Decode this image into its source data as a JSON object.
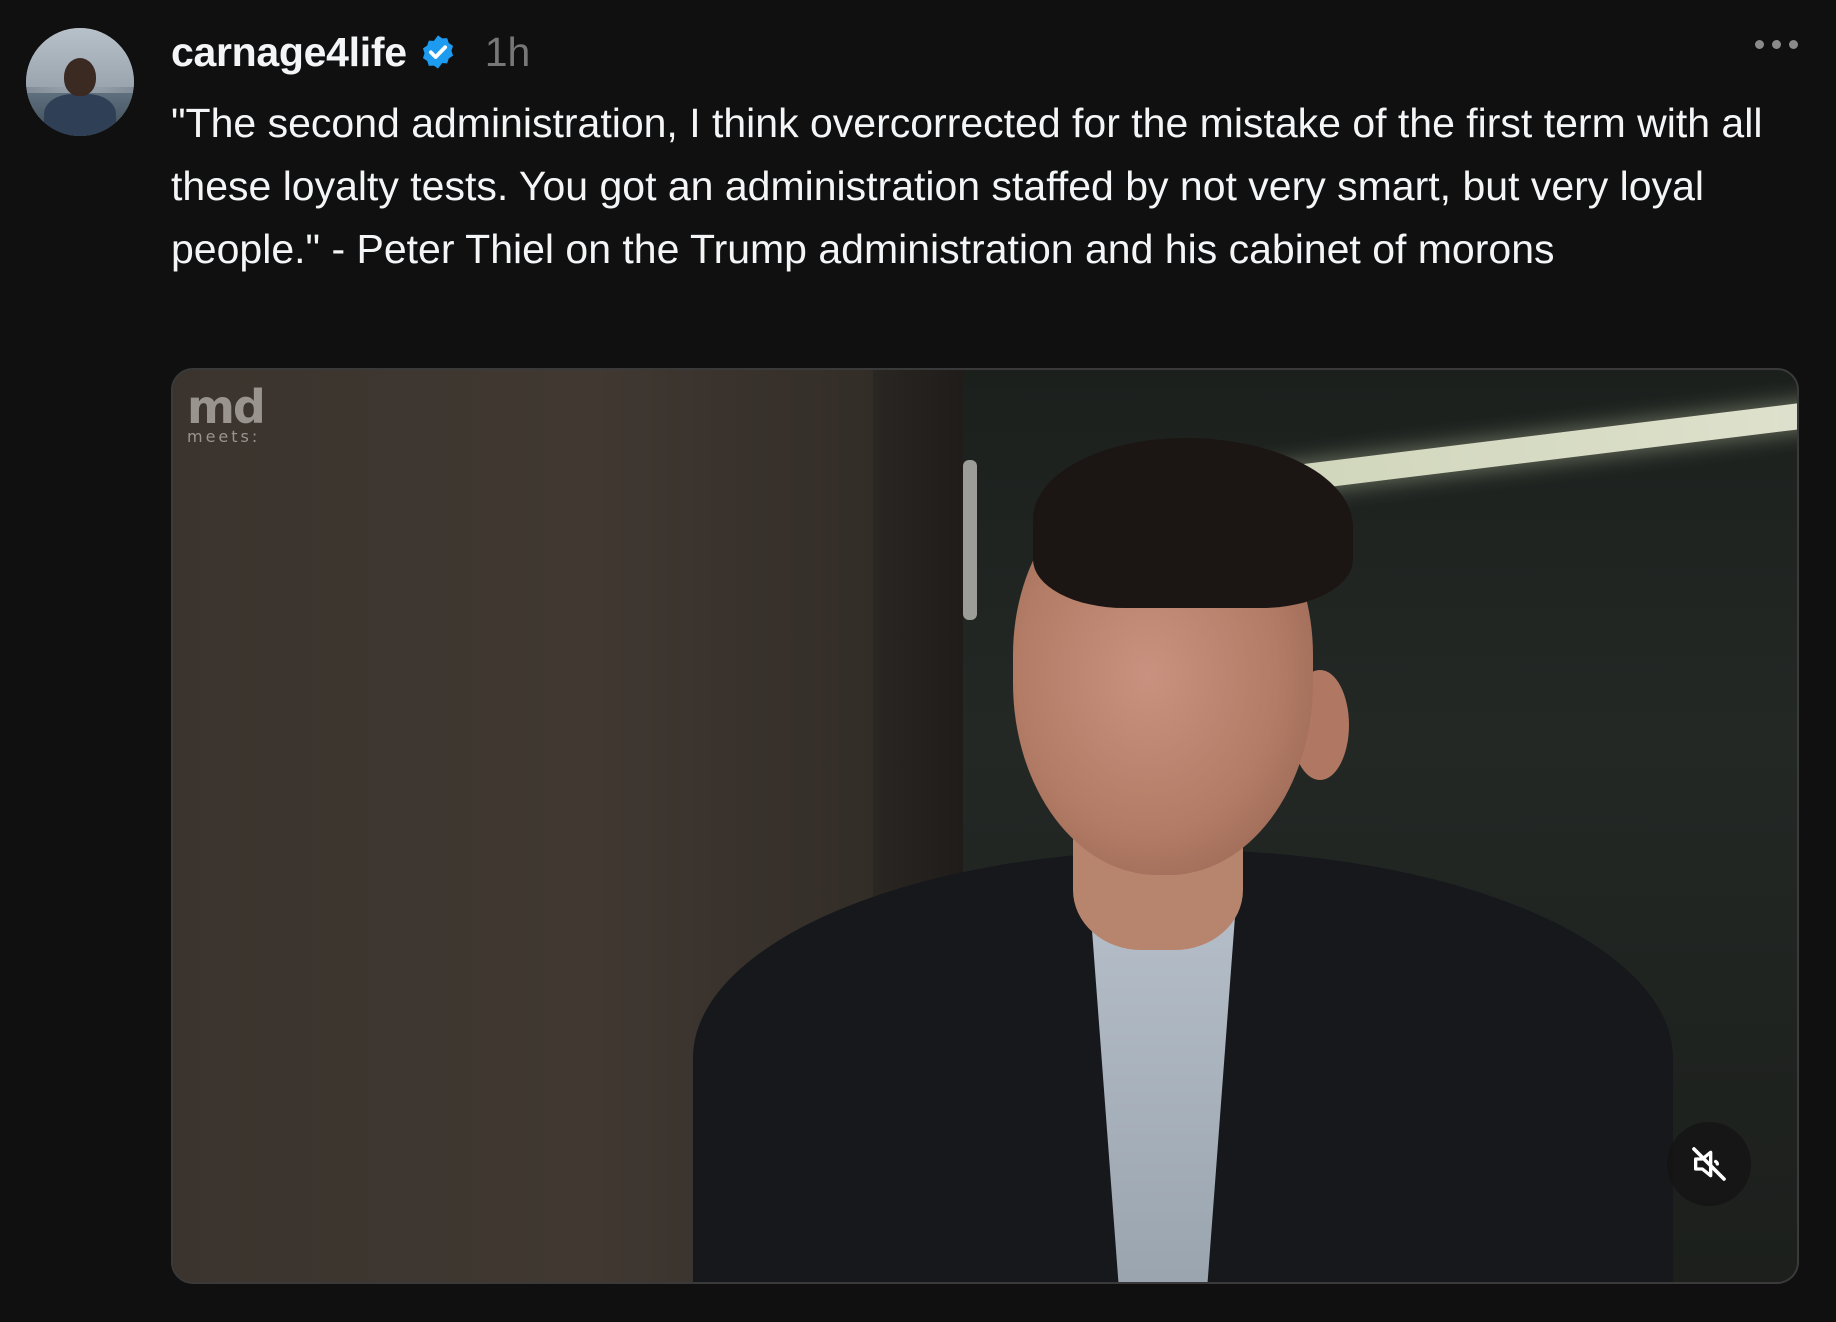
{
  "post": {
    "username": "carnage4life",
    "verified_icon": "verified-badge-icon",
    "time": "1h",
    "more_icon": "more-options-icon",
    "text": "\"The second administration, I think overcorrected for the mistake of the first term with all these loyalty tests. You got an administration staffed by not very smart, but very loyal people.\" - Peter Thiel on the Trump administration and his cabinet of morons",
    "video": {
      "watermark_main": "md",
      "watermark_sub": "meets:",
      "mute_icon": "speaker-muted-icon"
    }
  },
  "colors": {
    "background": "#101010",
    "text": "#f3f5f7",
    "muted_text": "#777777",
    "verified_blue": "#1d9bf0"
  }
}
